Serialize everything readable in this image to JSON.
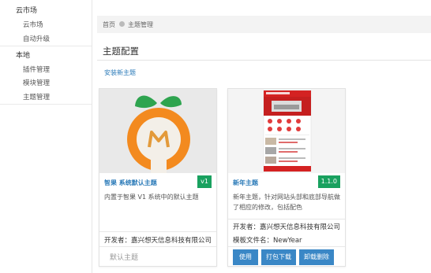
{
  "sidebar": {
    "groups": [
      {
        "label": "云市场",
        "items": [
          "云市场",
          "自动升级"
        ]
      },
      {
        "label": "本地",
        "items": [
          "插件管理",
          "模块管理",
          "主题管理"
        ]
      }
    ]
  },
  "breadcrumb": {
    "home": "首页",
    "current": "主题管理"
  },
  "page": {
    "title": "主题配置",
    "install_link": "安装新主题"
  },
  "themes": [
    {
      "title": "智果 系统默认主题",
      "version": "v1",
      "description": "内置于智果 V1 系统中的默认主题",
      "developer": "开发者：嘉兴想天信息科技有限公司",
      "default_label": "默认主题"
    },
    {
      "title": "新年主题",
      "version": "1.1.0",
      "description": "新年主题，针对网站头部和底部导航做了相应的修改，包括配色",
      "developer": "开发者：嘉兴想天信息科技有限公司",
      "template_file": "模板文件名：NewYear",
      "buttons": [
        "使用",
        "打包下载",
        "卸载删除"
      ]
    }
  ],
  "colors": {
    "link": "#2a7ab8",
    "version_badge": "#19a15f",
    "button": "#3a87c6",
    "orange": "#f38a1f",
    "leaf": "#2ea44f"
  }
}
